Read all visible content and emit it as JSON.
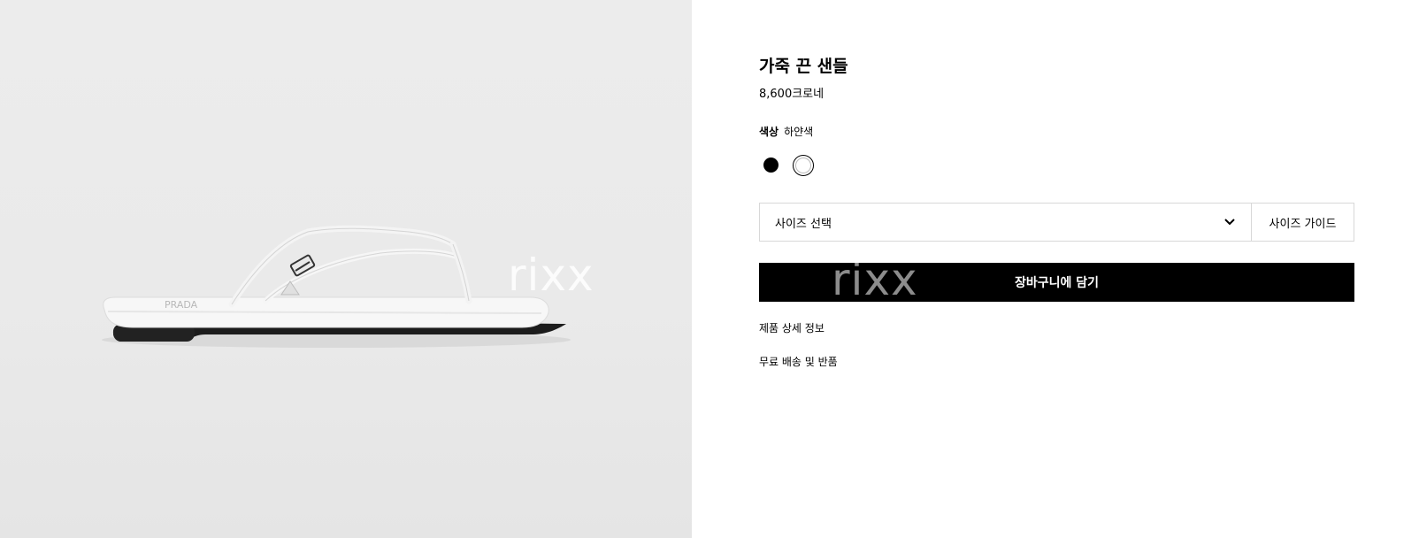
{
  "product": {
    "title": "가죽 끈 샌들",
    "price": "8,600크로네",
    "color_label": "색상",
    "color_value": "하얀색",
    "swatches": [
      {
        "name": "black",
        "hex": "#000000"
      },
      {
        "name": "white",
        "hex": "#ffffff"
      }
    ]
  },
  "size": {
    "select_label": "사이즈 선택",
    "guide_label": "사이즈 가이드"
  },
  "cart": {
    "button_label": "장바구니에 담기"
  },
  "links": {
    "details": "제품 상세 정보",
    "shipping": "무료 배송 및 반품"
  },
  "watermark": "rixx",
  "colors": {
    "image_background": "#eaeaea",
    "button_background": "#000000",
    "border": "#d8d8d8"
  }
}
